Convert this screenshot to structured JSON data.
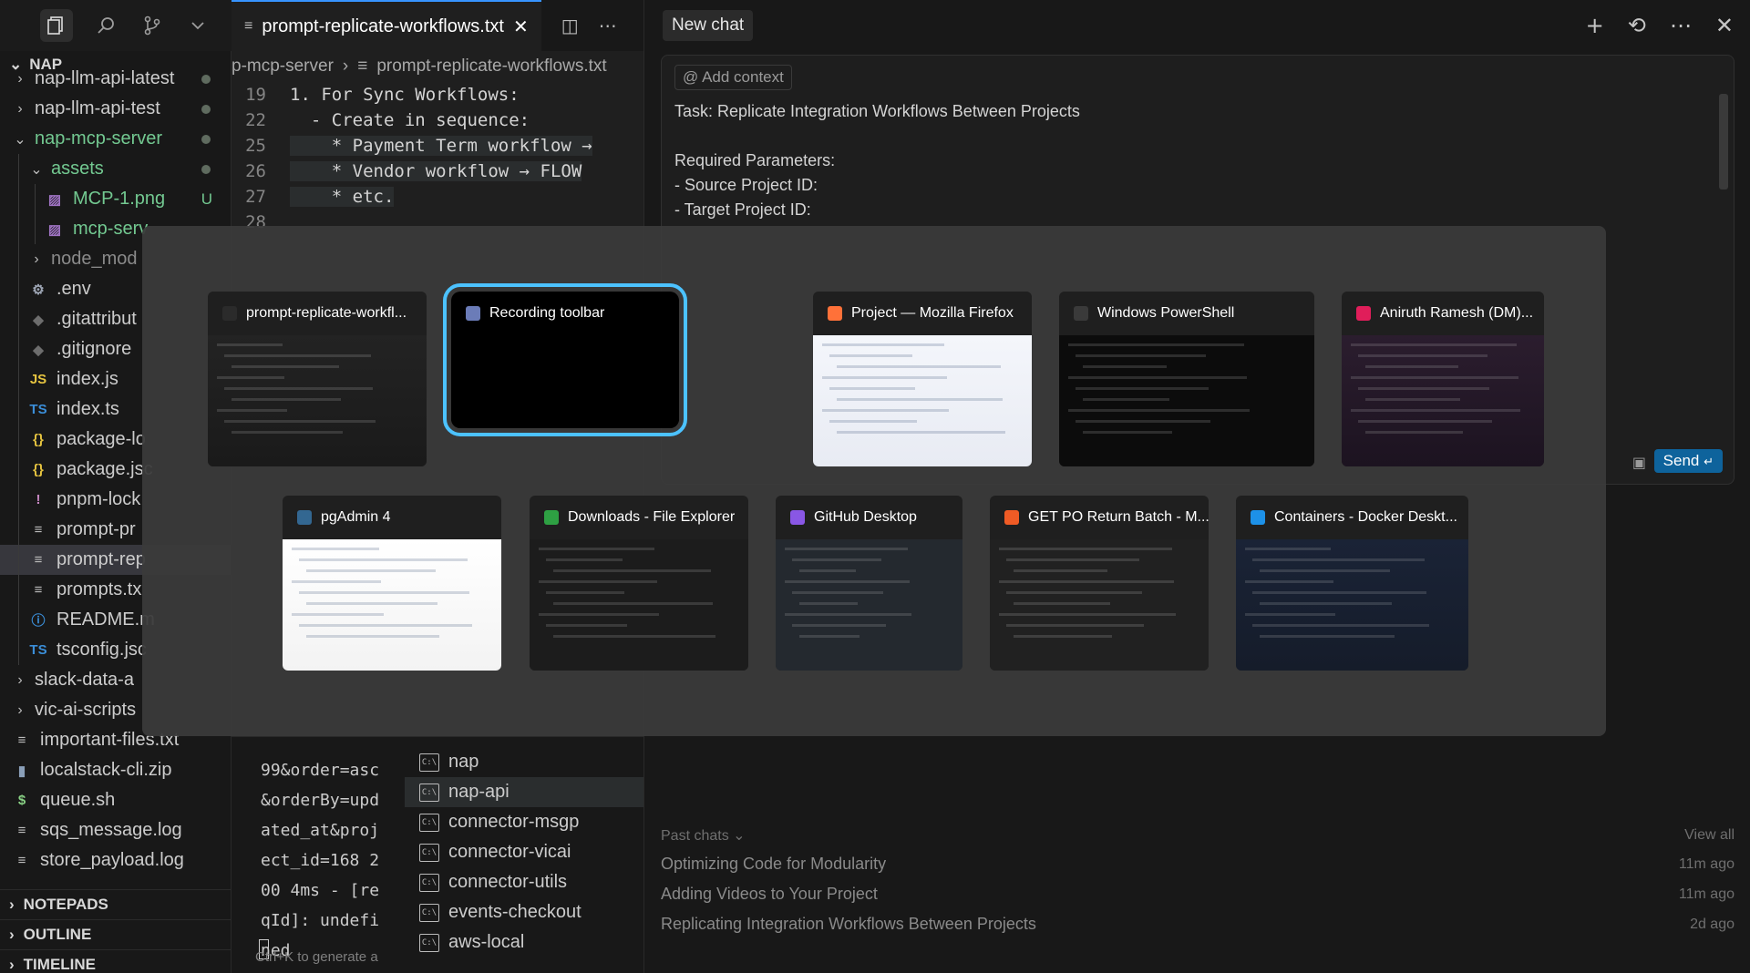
{
  "explorer": {
    "root": "NAP",
    "items": [
      {
        "label": "nap-llm-api-latest",
        "kind": "folder",
        "open": false,
        "level": 1
      },
      {
        "label": "nap-llm-api-test",
        "kind": "folder",
        "open": false,
        "level": 1
      },
      {
        "label": "nap-mcp-server",
        "kind": "folder",
        "open": true,
        "level": 1,
        "green": true
      },
      {
        "label": "assets",
        "kind": "folder",
        "open": true,
        "level": 2,
        "green": true
      },
      {
        "label": "MCP-1.png",
        "kind": "image",
        "level": 3,
        "green": true,
        "badge": "U"
      },
      {
        "label": "mcp-serv",
        "kind": "image",
        "level": 3,
        "green": true
      },
      {
        "label": "node_mod",
        "kind": "folder",
        "open": false,
        "level": 2,
        "dim": true
      },
      {
        "label": ".env",
        "kind": "gear",
        "level": 2
      },
      {
        "label": ".gitattribut",
        "kind": "git",
        "level": 2
      },
      {
        "label": ".gitignore",
        "kind": "git",
        "level": 2
      },
      {
        "label": "index.js",
        "kind": "js",
        "level": 2
      },
      {
        "label": "index.ts",
        "kind": "ts",
        "level": 2
      },
      {
        "label": "package-lo",
        "kind": "json",
        "level": 2
      },
      {
        "label": "package.jsc",
        "kind": "json",
        "level": 2
      },
      {
        "label": "pnpm-lock",
        "kind": "yaml",
        "level": 2
      },
      {
        "label": "prompt-pr",
        "kind": "txt",
        "level": 2
      },
      {
        "label": "prompt-rep",
        "kind": "txt",
        "level": 2,
        "selected": true
      },
      {
        "label": "prompts.tx",
        "kind": "txt",
        "level": 2
      },
      {
        "label": "README.m",
        "kind": "info",
        "level": 2
      },
      {
        "label": "tsconfig.jsc",
        "kind": "tsconfig",
        "level": 2
      },
      {
        "label": "slack-data-a",
        "kind": "folder",
        "open": false,
        "level": 1
      },
      {
        "label": "vic-ai-scripts",
        "kind": "folder",
        "open": false,
        "level": 1
      },
      {
        "label": "important-files.txt",
        "kind": "txt",
        "level": 1
      },
      {
        "label": "localstack-cli.zip",
        "kind": "zip",
        "level": 1
      },
      {
        "label": "queue.sh",
        "kind": "sh",
        "level": 1
      },
      {
        "label": "sqs_message.log",
        "kind": "txt",
        "level": 1
      },
      {
        "label": "store_payload.log",
        "kind": "txt",
        "level": 1
      }
    ],
    "sections": [
      "NOTEPADS",
      "OUTLINE",
      "TIMELINE"
    ]
  },
  "editor": {
    "tab_label": "prompt-replicate-workflows.txt",
    "breadcrumb_parent": "p-mcp-server",
    "breadcrumb_file": "prompt-replicate-workflows.txt",
    "lines": [
      {
        "num": "19",
        "text": "1. For Sync Workflows:",
        "hl": false
      },
      {
        "num": "22",
        "text": "  - Create in sequence:",
        "hl": false
      },
      {
        "num": "25",
        "text": "    * Payment Term workflow →",
        "hl": true
      },
      {
        "num": "26",
        "text": "    * Vendor workflow → FLOW",
        "hl": true
      },
      {
        "num": "27",
        "text": "    * etc.",
        "hl": true
      },
      {
        "num": "28",
        "text": "",
        "hl": false
      }
    ]
  },
  "terminal": {
    "output": "99&order=asc\n&orderBy=upd\nated_at&proj\nect_id=168 2\n00 4ms - [re\nqId]: undefi\nned",
    "hint": "Ctrl+K to generate a",
    "list": [
      "nap",
      "nap-api",
      "connector-msgp",
      "connector-vicai",
      "connector-utils",
      "events-checkout",
      "aws-local"
    ],
    "selected_index": 1
  },
  "chat": {
    "tab_label": "New chat",
    "add_context": "Add context",
    "task_lines": "Task: Replicate Integration Workflows Between Projects\n\nRequired Parameters:\n- Source Project ID:\n- Target Project ID:",
    "send_label": "Send",
    "past_chats_label": "Past chats",
    "view_all": "View all",
    "past_chats": [
      {
        "title": "Optimizing Code for Modularity",
        "ago": "11m ago"
      },
      {
        "title": "Adding Videos to Your Project",
        "ago": "11m ago"
      },
      {
        "title": "Replicating Integration Workflows Between Projects",
        "ago": "2d ago"
      }
    ]
  },
  "switcher": {
    "windows": [
      {
        "title": "prompt-replicate-workfl...",
        "icon": "cursor-icon",
        "color": "#2b2b2b"
      },
      {
        "title": "Recording toolbar",
        "icon": "recording-icon",
        "color": "#6b7cb8",
        "focused": true
      },
      {
        "title": "Project — Mozilla Firefox",
        "icon": "firefox-icon",
        "color": "#ff7139"
      },
      {
        "title": "Windows PowerShell",
        "icon": "powershell-icon",
        "color": "#3a3a3a"
      },
      {
        "title": "Aniruth Ramesh (DM)...",
        "icon": "slack-icon",
        "color": "#e01e5a"
      },
      {
        "title": "pgAdmin 4",
        "icon": "pgadmin-icon",
        "color": "#336791"
      },
      {
        "title": "Downloads - File Explorer",
        "icon": "folder-icon",
        "color": "#2ea043"
      },
      {
        "title": "GitHub Desktop",
        "icon": "github-icon",
        "color": "#8957e5"
      },
      {
        "title": "GET PO Return Batch - M...",
        "icon": "postman-icon",
        "color": "#ef5b25"
      },
      {
        "title": "Containers - Docker Deskt...",
        "icon": "docker-icon",
        "color": "#1d91e8"
      }
    ]
  }
}
